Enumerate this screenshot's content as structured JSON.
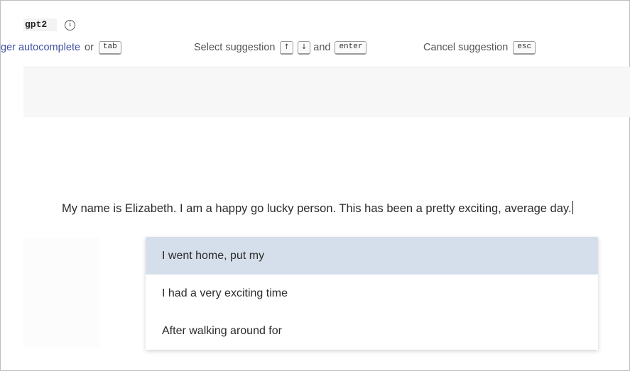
{
  "model": {
    "name": "gpt2",
    "info_icon": "info-circle-icon",
    "info_glyph": "i"
  },
  "shortcuts": {
    "trigger_text": "ger autocomplete",
    "or_text": "or",
    "trigger_key": "tab",
    "select_text": "Select suggestion",
    "up_key": "↑",
    "down_key": "↓",
    "and_text": "and",
    "enter_key": "enter",
    "cancel_text": "Cancel suggestion",
    "cancel_key": "esc"
  },
  "editor": {
    "text": "My name is Elizabeth. I am a happy go lucky person. This has been a pretty exciting, average day."
  },
  "suggestions": {
    "items": [
      "I went home, put my",
      "I had a very exciting time",
      "After walking around for"
    ],
    "selected_index": 0
  },
  "colors": {
    "link": "#3f4fa0",
    "selected_suggestion_bg": "#d5dfec",
    "band_bg": "#f7f7f8"
  }
}
